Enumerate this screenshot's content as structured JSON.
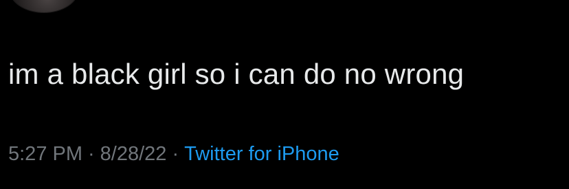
{
  "tweet": {
    "text": "im a black girl so i can do no wrong",
    "time": "5:27 PM",
    "separator": "·",
    "date": "8/28/22",
    "source": "Twitter for iPhone"
  },
  "colors": {
    "background": "#000000",
    "text": "#e7e9ea",
    "meta": "#71767b",
    "source_link": "#1d9bf0"
  }
}
